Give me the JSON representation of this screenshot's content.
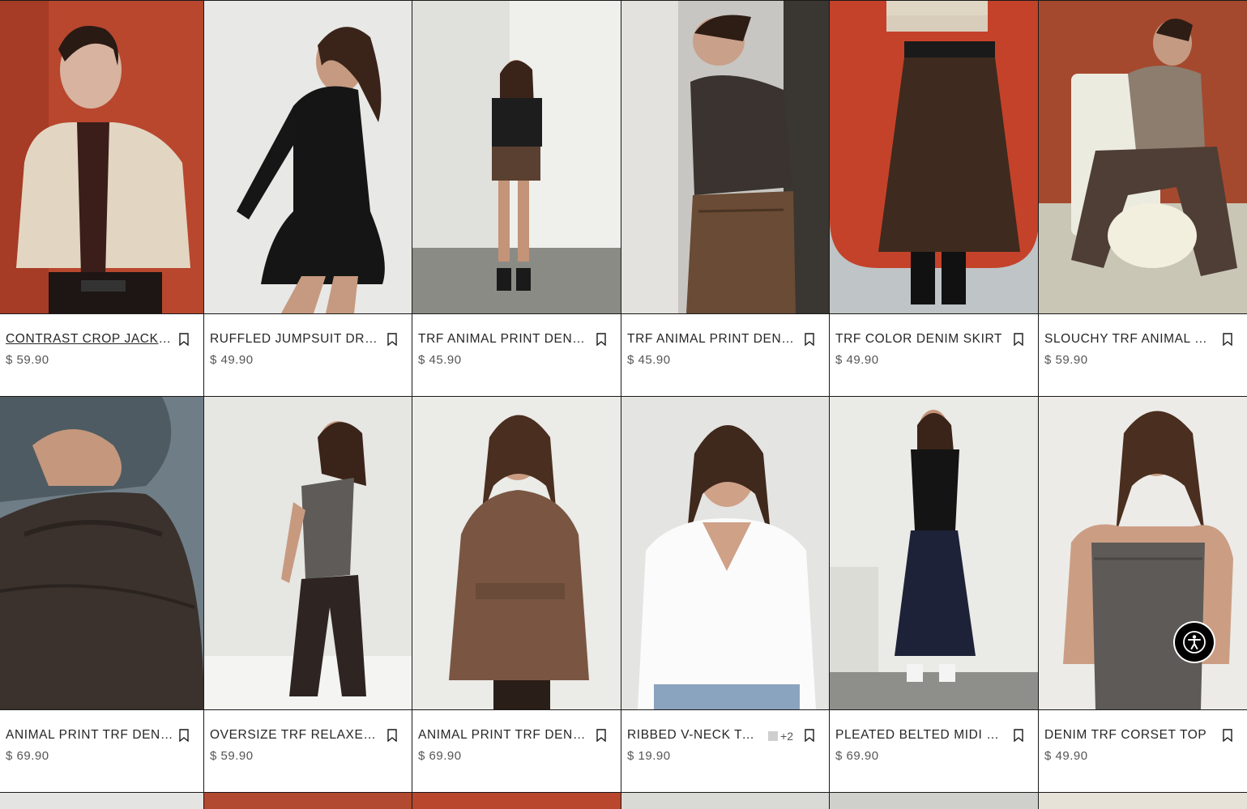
{
  "products": [
    {
      "name": "CONTRAST CROP JACKET",
      "price": "$ 59.90"
    },
    {
      "name": "RUFFLED JUMPSUIT DRESS",
      "price": "$ 49.90"
    },
    {
      "name": "TRF ANIMAL PRINT DENIM TOP",
      "price": "$ 45.90"
    },
    {
      "name": "TRF ANIMAL PRINT DENIM SKIRT",
      "price": "$ 45.90"
    },
    {
      "name": "TRF COLOR DENIM SKIRT",
      "price": "$ 49.90"
    },
    {
      "name": "SLOUCHY TRF ANIMAL PRINT JEANS",
      "price": "$ 59.90"
    },
    {
      "name": "ANIMAL PRINT TRF DENIM JACKET",
      "price": "$ 69.90"
    },
    {
      "name": "OVERSIZE TRF RELAXED JEANS",
      "price": "$ 59.90"
    },
    {
      "name": "ANIMAL PRINT TRF DENIM JACKET",
      "price": "$ 69.90"
    },
    {
      "name": "RIBBED V-NECK T-SHIRT",
      "price": "$ 19.90",
      "more_colors": "+2"
    },
    {
      "name": "PLEATED BELTED MIDI SKIRT",
      "price": "$ 69.90"
    },
    {
      "name": "DENIM TRF CORSET TOP",
      "price": "$ 49.90"
    }
  ],
  "icons": {
    "save": "bookmark-icon",
    "accessibility": "accessibility-icon"
  }
}
